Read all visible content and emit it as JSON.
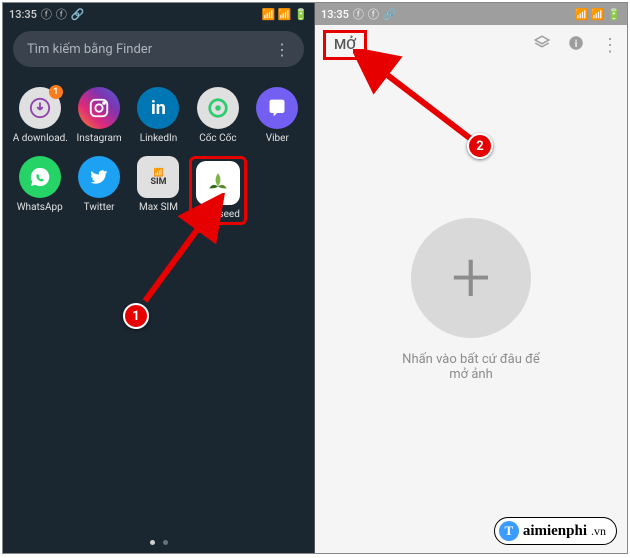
{
  "status": {
    "time": "13:35",
    "right_icons": "📶 📶 🔋"
  },
  "search": {
    "placeholder": "Tìm kiếm bằng Finder"
  },
  "apps": {
    "row1": [
      {
        "label": "A download…",
        "icon": "download-icon",
        "badge": "1"
      },
      {
        "label": "Instagram",
        "icon": "instagram-icon"
      },
      {
        "label": "LinkedIn",
        "icon": "linkedin-icon",
        "glyph": "in"
      },
      {
        "label": "Cốc Cốc",
        "icon": "coccoc-icon"
      },
      {
        "label": "Viber",
        "icon": "viber-icon"
      }
    ],
    "row2": [
      {
        "label": "WhatsApp",
        "icon": "whatsapp-icon"
      },
      {
        "label": "Twitter",
        "icon": "twitter-icon"
      },
      {
        "label": "Max SIM",
        "icon": "maxsim-icon"
      },
      {
        "label": "Snapseed",
        "icon": "snapseed-icon",
        "highlight": true
      }
    ]
  },
  "right_panel": {
    "open_label": "MỞ",
    "hint": "Nhấn vào bất cứ đâu để mở ảnh"
  },
  "steps": {
    "one": "1",
    "two": "2"
  },
  "watermark": {
    "t": "T",
    "site": "aimienphi",
    "ext": ".vn"
  }
}
